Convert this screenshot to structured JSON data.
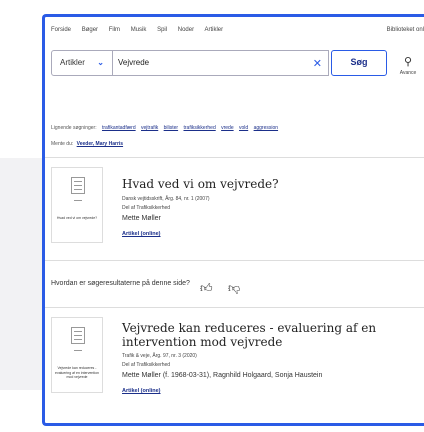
{
  "nav": {
    "links": [
      "Forside",
      "Bøger",
      "Film",
      "Musik",
      "Spil",
      "Noder",
      "Artikler"
    ],
    "right_link": "Biblioteket onl"
  },
  "search": {
    "category": "Artikler",
    "query": "Vejvrede",
    "submit_label": "Søg",
    "advanced_label": "Avance"
  },
  "related": {
    "label": "Lignende søgninger:",
    "terms": [
      "trafikantadfærd",
      "vejtrafik",
      "bilister",
      "trafiksikkerhed",
      "vrede",
      "vold",
      "aggression"
    ]
  },
  "meant": {
    "label": "Mente du:",
    "suggestion": "Veeder, Mary Harris"
  },
  "results": [
    {
      "title": "Hvad ved vi om vejvrede?",
      "meta": [
        "Dansk vejtidsskrift, Årg. 84, nr. 1 (2007)",
        "Del af Trafiksikkerhed"
      ],
      "authors": "Mette Møller",
      "format": "Artikel (online)",
      "thumb_title": "Hvad ved vi om vejvrede?"
    },
    {
      "title": "Vejvrede kan reduceres - evaluering af en intervention mod vejvrede",
      "meta": [
        "Trafik & veje, Årg. 97, nr. 3 (2020)",
        "Del af Trafiksikkerhed"
      ],
      "authors": "Mette Møller (f. 1968-03-31), Ragnhild Holgaard, Sonja Haustein",
      "format": "Artikel (online)",
      "thumb_title": "Vejvrede kan reduceres - evaluering af en intervention mod vejvrede"
    }
  ],
  "feedback": {
    "question": "Hvordan er søgeresultaterne på denne side?"
  },
  "colors": {
    "accent": "#2a5be6",
    "link": "#1b2f8a"
  }
}
